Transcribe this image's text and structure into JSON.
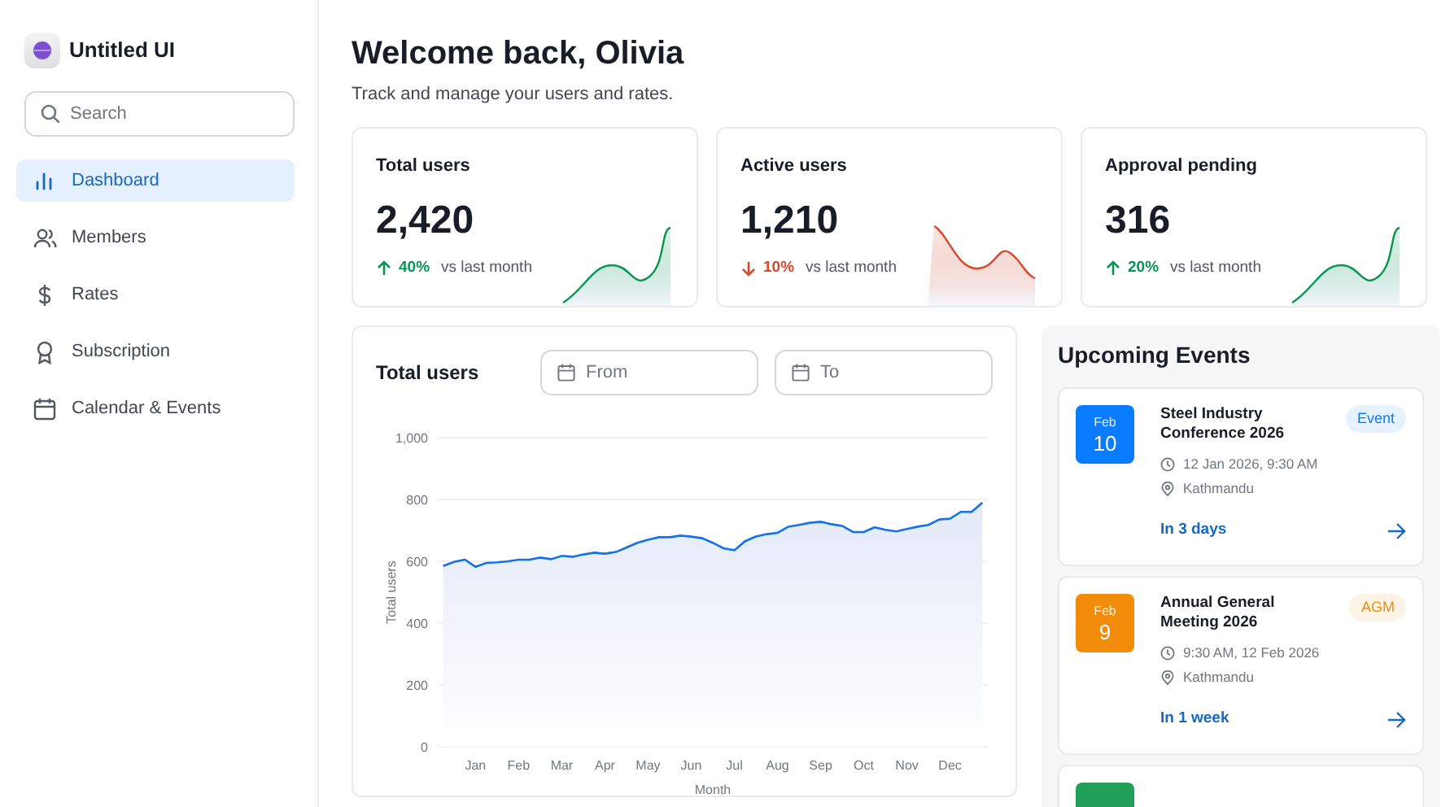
{
  "brand": {
    "name": "Untitled UI"
  },
  "search": {
    "placeholder": "Search"
  },
  "nav": [
    {
      "label": "Dashboard",
      "selected": true
    },
    {
      "label": "Members",
      "selected": false
    },
    {
      "label": "Rates",
      "selected": false
    },
    {
      "label": "Subscription",
      "selected": false
    },
    {
      "label": "Calendar & Events",
      "selected": false
    }
  ],
  "header": {
    "title": "Welcome back, Olivia",
    "subtitle": "Track and manage your users and rates."
  },
  "stats": [
    {
      "label": "Total users",
      "value": "2,420",
      "kind": "up",
      "change": "40%",
      "note": "vs last month"
    },
    {
      "label": "Active users",
      "value": "1,210",
      "kind": "down",
      "change": "10%",
      "note": "vs last month"
    },
    {
      "label": "Approval pending",
      "value": "316",
      "kind": "up",
      "change": "20%",
      "note": "vs last month"
    }
  ],
  "chart_card": {
    "title": "Total users",
    "date_from": {
      "placeholder": "From"
    },
    "date_to": {
      "placeholder": "To"
    },
    "chart_data": {
      "type": "area",
      "grid": true,
      "xlabel": "Month",
      "ylabel": "Total users",
      "ylim": [
        0,
        1000
      ],
      "yticks": [
        {
          "value": 0,
          "label": "0"
        },
        {
          "value": 200,
          "label": "200"
        },
        {
          "value": 400,
          "label": "400"
        },
        {
          "value": 600,
          "label": "600"
        },
        {
          "value": 800,
          "label": "800"
        },
        {
          "value": 1000,
          "label": "1,000"
        }
      ],
      "categories": [
        null,
        null,
        null,
        "Jan",
        null,
        null,
        null,
        "Feb",
        null,
        null,
        null,
        "Mar",
        null,
        null,
        null,
        "Apr",
        null,
        null,
        null,
        "May",
        null,
        null,
        null,
        "Jun",
        null,
        null,
        null,
        "Jul",
        null,
        null,
        null,
        "Aug",
        null,
        null,
        null,
        "Sep",
        null,
        null,
        null,
        "Oct",
        null,
        null,
        null,
        "Nov",
        null,
        null,
        null,
        "Dec",
        null,
        null,
        null
      ],
      "series": [
        {
          "color": "#1570ef",
          "values": [
            585,
            598,
            605,
            582,
            595,
            597,
            600,
            605,
            605,
            612,
            607,
            618,
            615,
            622,
            628,
            625,
            630,
            645,
            660,
            670,
            678,
            678,
            683,
            680,
            675,
            660,
            642,
            636,
            665,
            680,
            688,
            692,
            712,
            718,
            725,
            728,
            720,
            715,
            695,
            695,
            710,
            702,
            697,
            705,
            712,
            718,
            735,
            738,
            760,
            760,
            790
          ]
        }
      ]
    }
  },
  "events_panel": {
    "title": "Upcoming Events",
    "events": [
      {
        "month": "Feb",
        "day": "10",
        "color": "#0a7cff",
        "title": "Steel Industry Conference 2026",
        "tag": "Event",
        "time": "12 Jan 2026, 9:30 AM",
        "place": "Kathmandu",
        "due": "In 3 days"
      },
      {
        "month": "Feb",
        "day": "9",
        "color": "#f08c0a",
        "title": "Annual General Meeting 2026",
        "tag": "AGM",
        "time": "9:30 AM, 12 Feb 2026",
        "place": "Kathmandu",
        "due": "In 1 week"
      },
      {
        "color": "#22a05a"
      }
    ]
  }
}
